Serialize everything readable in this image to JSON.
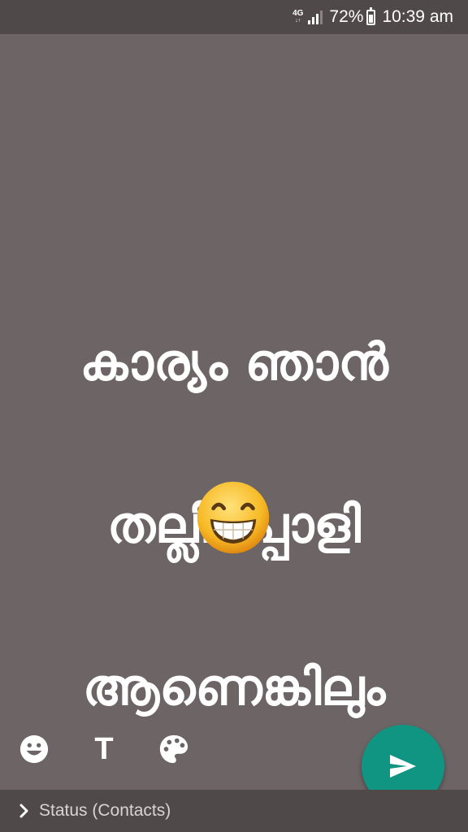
{
  "status_bar": {
    "network": "4G",
    "battery": "72%",
    "battery_level": 0.72,
    "time": "10:39 am"
  },
  "status_text": {
    "line1": "കാര്യം ഞാൻ",
    "line2": "തല്ലിപ്പൊളി",
    "line3": "ആണെങ്കിലും",
    "emoji": "grinning-face-with-smiling-eyes"
  },
  "toolbar": {
    "emoji_icon": "smiley-icon",
    "text_label": "T",
    "palette_icon": "palette-icon"
  },
  "send": {
    "icon": "send-icon",
    "color": "#109582"
  },
  "audience": {
    "label": "Status (Contacts)"
  },
  "colors": {
    "background": "#6d6466",
    "bars": "#4f494a"
  }
}
